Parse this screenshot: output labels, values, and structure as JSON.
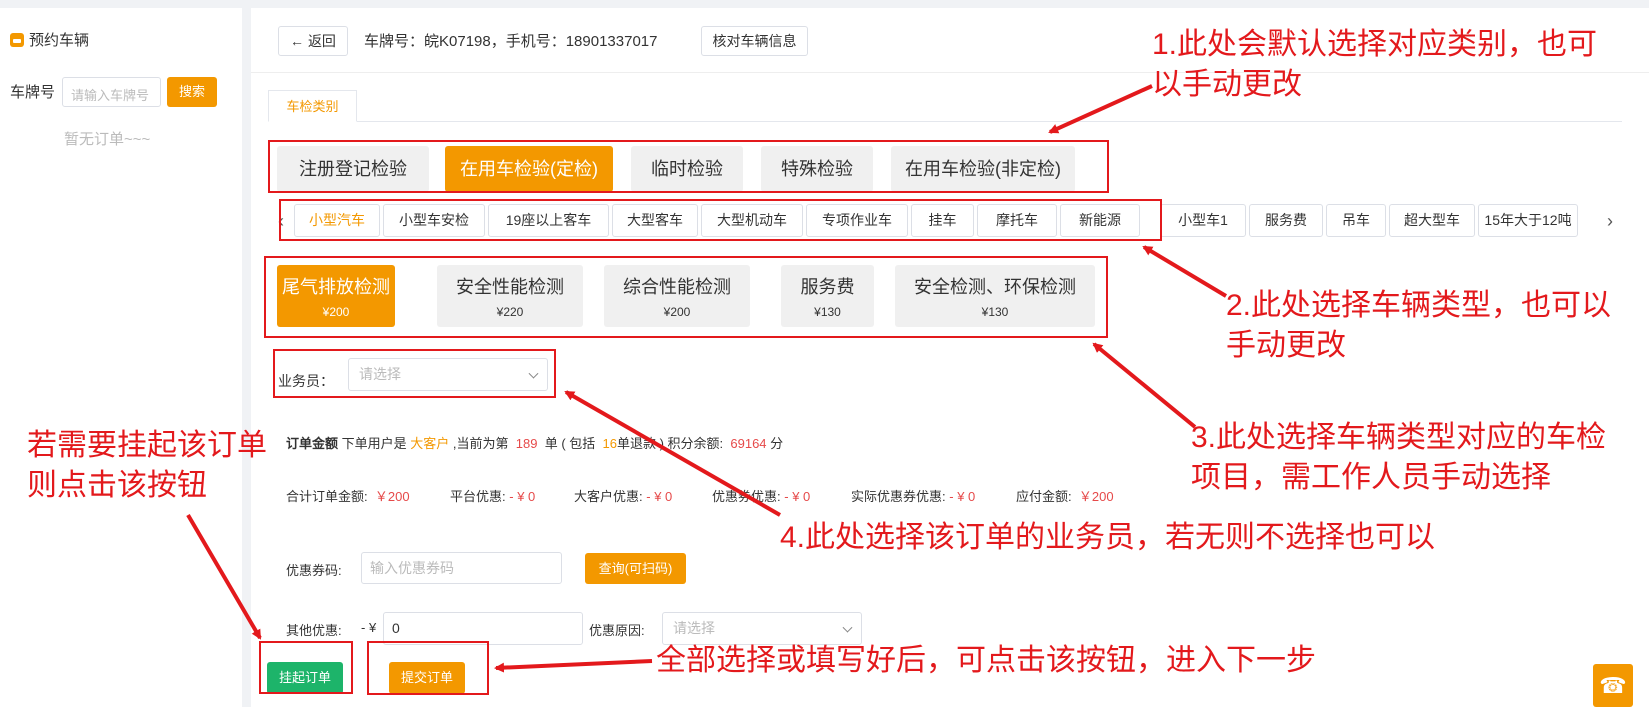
{
  "sidebar": {
    "title": "预约车辆",
    "plate_label": "车牌号",
    "plate_placeholder": "请输入车牌号",
    "search_button": "搜索",
    "empty_text": "暂无订单~~~"
  },
  "header": {
    "back_label": "返回",
    "plate_info": "车牌号：皖K07198，手机号：18901337017",
    "verify_button": "核对车辆信息"
  },
  "tab": {
    "label": "车检类别"
  },
  "categories": [
    {
      "label": "注册登记检验",
      "active": false
    },
    {
      "label": "在用车检验(定检)",
      "active": true
    },
    {
      "label": "临时检验",
      "active": false
    },
    {
      "label": "特殊检验",
      "active": false
    },
    {
      "label": "在用车检验(非定检)",
      "active": false
    }
  ],
  "vehicle_types": [
    {
      "label": "小型汽车",
      "active": true
    },
    {
      "label": "小型车安检",
      "active": false
    },
    {
      "label": "19座以上客车",
      "active": false
    },
    {
      "label": "大型客车",
      "active": false
    },
    {
      "label": "大型机动车",
      "active": false
    },
    {
      "label": "专项作业车",
      "active": false
    },
    {
      "label": "挂车",
      "active": false
    },
    {
      "label": "摩托车",
      "active": false
    },
    {
      "label": "新能源",
      "active": false
    },
    {
      "label": "小型车1",
      "active": false
    },
    {
      "label": "服务费",
      "active": false
    },
    {
      "label": "吊车",
      "active": false
    },
    {
      "label": "超大型车",
      "active": false
    },
    {
      "label": "15年大于12吨",
      "active": false
    }
  ],
  "items": [
    {
      "name": "尾气排放检测",
      "price": "¥200",
      "active": true
    },
    {
      "name": "安全性能检测",
      "price": "¥220",
      "active": false
    },
    {
      "name": "综合性能检测",
      "price": "¥200",
      "active": false
    },
    {
      "name": "服务费",
      "price": "¥130",
      "active": false
    },
    {
      "name": "安全检测、环保检测",
      "price": "¥130",
      "active": false
    }
  ],
  "salesman": {
    "label": "业务员：",
    "placeholder": "请选择"
  },
  "order": {
    "title": "订单金额",
    "text1": "下单用户是",
    "user_type": "大客户",
    "text2": ",当前为第",
    "order_no": "189",
    "text3": "单 ( 包括",
    "refund_count": "16",
    "text4": "单退款 ) 积分余额:",
    "points": "69164",
    "text5": "分"
  },
  "summary": [
    {
      "label": "合计订单金额:",
      "value": "￥200"
    },
    {
      "label": "平台优惠:",
      "value": "- ¥ 0"
    },
    {
      "label": "大客户优惠:",
      "value": "- ¥ 0"
    },
    {
      "label": "优惠券优惠:",
      "value": "- ¥ 0"
    },
    {
      "label": "实际优惠券优惠:",
      "value": "- ¥ 0"
    },
    {
      "label": "应付金额:",
      "value": "￥200"
    }
  ],
  "coupon": {
    "label": "优惠券码:",
    "placeholder": "输入优惠券码",
    "button": "查询(可扫码)"
  },
  "other": {
    "label": "其他优惠:",
    "prefix": "- ¥",
    "value": "0",
    "reason_label": "优惠原因:",
    "reason_placeholder": "请选择"
  },
  "actions": {
    "hang_button": "挂起订单",
    "submit_button": "提交订单"
  },
  "annotations": {
    "a1": [
      "1.此处会默认选择对应类别，也可",
      "以手动更改"
    ],
    "a2": [
      "2.此处选择车辆类型，也可以",
      "手动更改"
    ],
    "a3": [
      "3.此处选择车辆类型对应的车检",
      "项目，需工作人员手动选择"
    ],
    "a4": "4.此处选择该订单的业务员，若无则不选择也可以",
    "a5": [
      "若需要挂起该订单",
      "则点击该按钮"
    ],
    "a6": "全部选择或填写好后，可点击该按钮，进入下一步"
  },
  "colors": {
    "accent": "#f39800",
    "green": "#1db46a",
    "annotation": "#e3191c"
  }
}
